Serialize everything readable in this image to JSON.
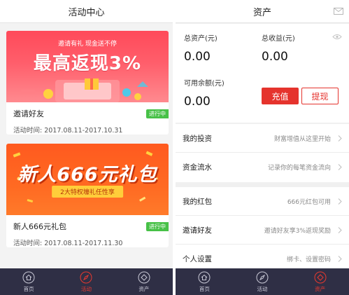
{
  "left": {
    "title": "活动中心",
    "cards": [
      {
        "banner_sub": "邀请有礼 现金送不停",
        "banner_main": "最高返现3%",
        "name": "邀请好友",
        "time": "活动时间: 2017.08.11-2017.10.31",
        "badge": "进行中"
      },
      {
        "banner_main": "新人666元礼包",
        "banner_ribbon": "2大特权壕礼任性享",
        "name": "新人666元礼包",
        "time": "活动时间: 2017.08.11-2017.11.30",
        "badge": "进行中"
      }
    ]
  },
  "right": {
    "title": "资产",
    "total_assets_label": "总资产(元)",
    "total_assets_value": "0.00",
    "total_income_label": "总收益(元)",
    "total_income_value": "0.00",
    "balance_label": "可用余额(元)",
    "balance_value": "0.00",
    "charge_label": "充值",
    "withdraw_label": "提现",
    "menu": [
      {
        "label": "我的投资",
        "hint": "财富增值从这里开始"
      },
      {
        "label": "资金流水",
        "hint": "记录你的每笔资金流向"
      },
      {
        "label": "我的红包",
        "hint": "666元红包可用"
      },
      {
        "label": "邀请好友",
        "hint": "邀请好友享3%返现奖励"
      },
      {
        "label": "个人设置",
        "hint": "绑卡、设置密码"
      }
    ]
  },
  "tabs": [
    {
      "label": "首页",
      "icon": "home-icon"
    },
    {
      "label": "活动",
      "icon": "compass-icon"
    },
    {
      "label": "资产",
      "icon": "diamond-icon"
    }
  ],
  "colors": {
    "accent": "#e5332d",
    "tabbar": "#2f2f45",
    "badge": "#47c147"
  }
}
